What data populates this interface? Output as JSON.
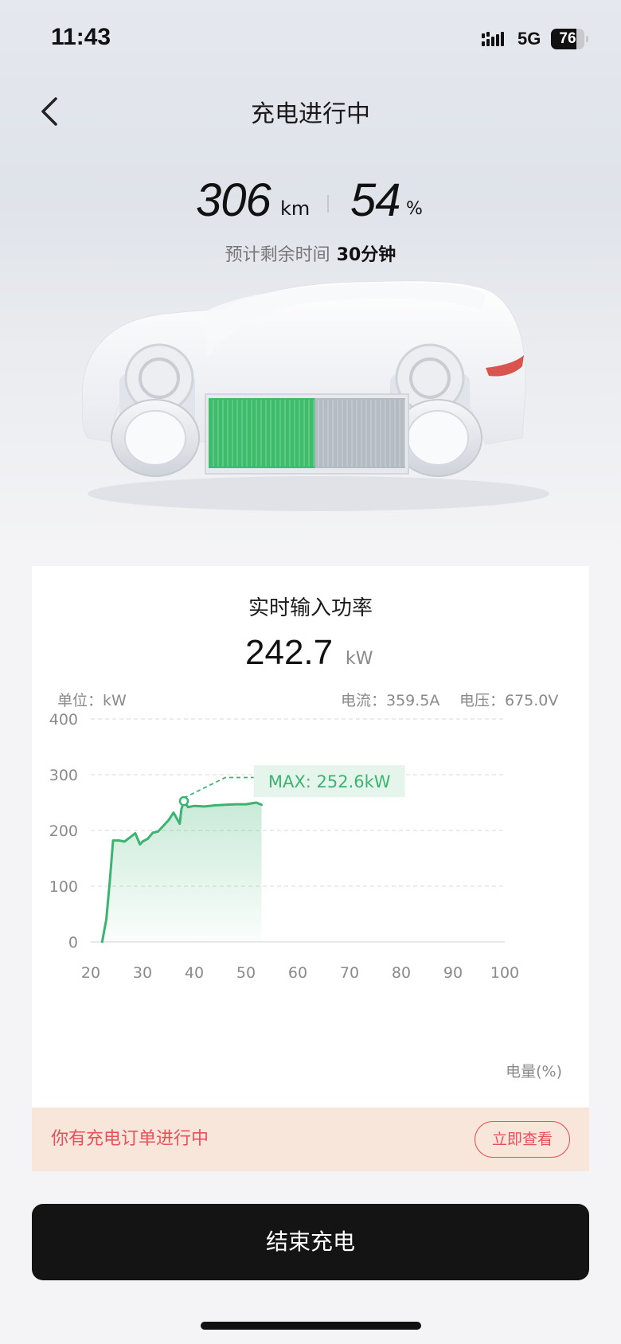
{
  "status_bar": {
    "time": "11:43",
    "network": "5G",
    "battery": "76",
    "battery_level": 0.76
  },
  "nav": {
    "title": "充电进行中",
    "back_icon": "chevron-left-icon"
  },
  "stats": {
    "range_value": "306",
    "range_unit": "km",
    "soc_value": "54",
    "soc_unit": "%",
    "remaining_label": "预计剩余时间",
    "remaining_value": "30分钟",
    "battery_charge_fraction": 0.54
  },
  "power_card": {
    "title": "实时输入功率",
    "value": "242.7",
    "unit": "kW",
    "unit_label": "单位：kW",
    "current_label": "电流：359.5A",
    "voltage_label": "电压：675.0V",
    "xaxis_title": "电量(%)"
  },
  "chart_data": {
    "type": "area",
    "title": "",
    "xlabel": "电量(%)",
    "ylabel": "单位：kW",
    "xlim": [
      20,
      100
    ],
    "ylim": [
      0,
      400
    ],
    "x_ticks": [
      20,
      30,
      40,
      50,
      60,
      70,
      80,
      90,
      100
    ],
    "y_ticks": [
      0,
      100,
      200,
      300,
      400
    ],
    "grid": true,
    "series": [
      {
        "color": "#3cb371",
        "x": [
          22.2,
          23,
          23.7,
          24.3,
          25.5,
          26.5,
          27.5,
          28.6,
          29.5,
          30,
          31,
          32,
          33,
          34,
          35,
          36,
          37.2,
          37.5,
          38,
          38.8,
          40,
          42,
          44,
          46,
          48,
          50,
          52,
          53
        ],
        "values": [
          0,
          40,
          110,
          182,
          182,
          180,
          187,
          195,
          175,
          180,
          185,
          196,
          198,
          208,
          218,
          232,
          212,
          238,
          252.6,
          242,
          244,
          243,
          245,
          246,
          247,
          247,
          250,
          246
        ]
      }
    ],
    "annotations": [
      {
        "text": "MAX: 252.6kW",
        "x": 38,
        "y": 252.6
      }
    ]
  },
  "order_banner": {
    "text": "你有充电订单进行中",
    "button": "立即查看"
  },
  "end_button": {
    "label": "结束充电"
  },
  "colors": {
    "accent_green": "#3cb371",
    "alert_red": "#e8505b",
    "banner_bg": "#f7e6d9",
    "button_dark": "#141414"
  }
}
